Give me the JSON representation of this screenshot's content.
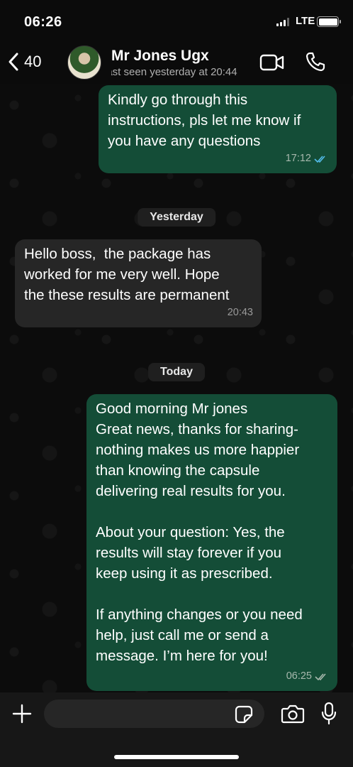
{
  "status_bar": {
    "time": "06:26",
    "network": "LTE"
  },
  "header": {
    "back_count": "40",
    "contact_name": "Mr Jones Ugx",
    "contact_status": "last seen yesterday at 20:44"
  },
  "chat": {
    "messages": [
      {
        "direction": "outgoing",
        "text": "Kindly go through this\ninstructions, pls let me know if\nyou have any questions",
        "time": "17:12",
        "status": "read"
      },
      {
        "direction": "incoming",
        "text": "Hello boss,  the package has\nworked for me very well. Hope\nthe these results are permanent",
        "time": "20:43"
      },
      {
        "direction": "outgoing",
        "text": "Good morning Mr jones\nGreat news, thanks for sharing-\nnothing makes us more happier\nthan knowing the capsule\ndelivering real results for you.\n\nAbout your question: Yes, the\nresults will stay forever if you\nkeep using it as prescribed.\n\nIf anything changes or you need\nhelp, just call me or send a\nmessage. I’m here for you!",
        "time": "06:25",
        "status": "delivered"
      }
    ],
    "day_separators": [
      "Yesterday",
      "Today"
    ]
  },
  "input_bar": {
    "placeholder": ""
  },
  "colors": {
    "outgoing_bubble": "#144d37",
    "incoming_bubble": "#262626",
    "read_tick": "#53bdeb",
    "delivered_tick": "#a7b8ad"
  },
  "icons": [
    "back-chevron-icon",
    "video-camera-icon",
    "phone-icon",
    "plus-icon",
    "sticker-icon",
    "camera-icon",
    "microphone-icon"
  ]
}
